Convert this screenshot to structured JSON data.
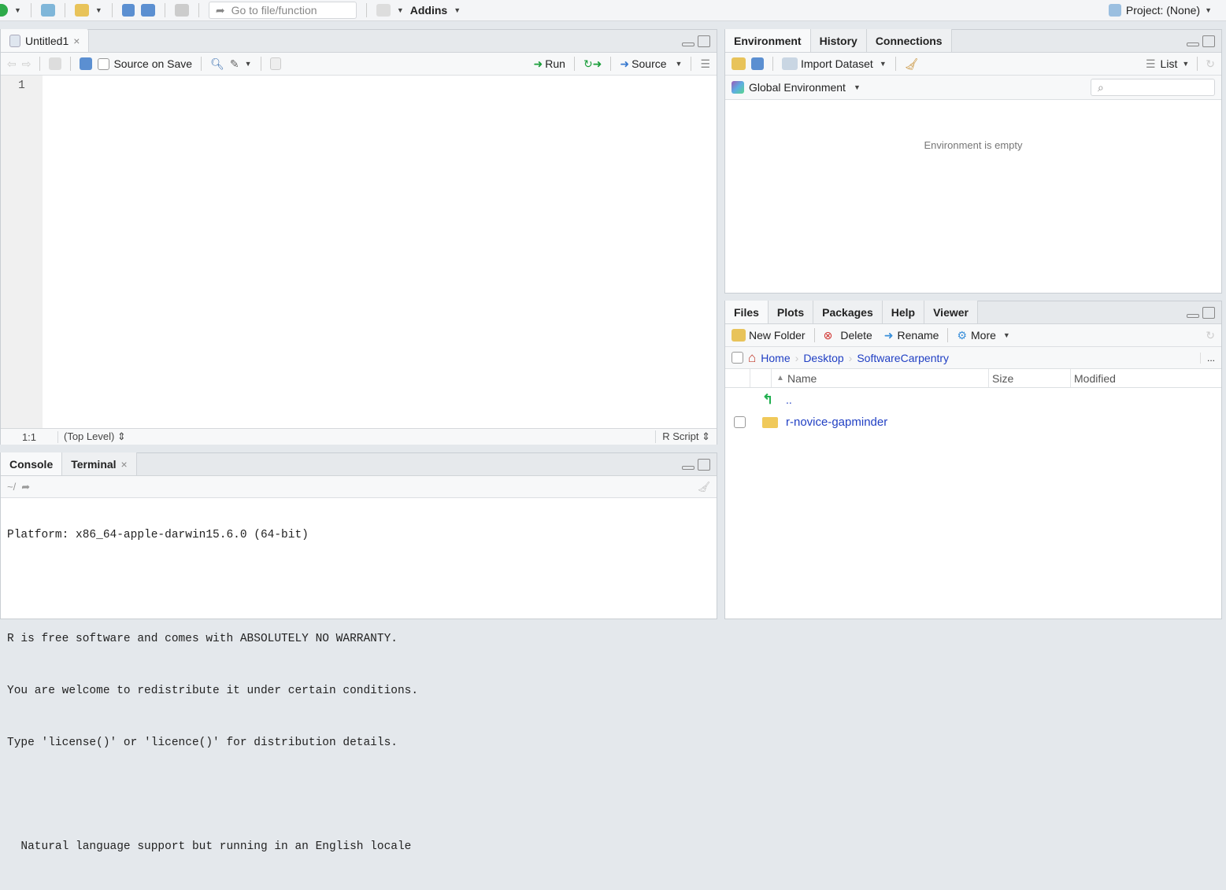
{
  "topbar": {
    "goto_placeholder": "Go to file/function",
    "addins": "Addins",
    "project": "Project: (None)"
  },
  "editor": {
    "tab": "Untitled1",
    "source_on_save": "Source on Save",
    "run": "Run",
    "source": "Source",
    "line_number": "1",
    "position": "1:1",
    "scope": "(Top Level)",
    "file_type": "R Script"
  },
  "console": {
    "tabs": [
      "Console",
      "Terminal"
    ],
    "path": "~/",
    "lines": [
      "Platform: x86_64-apple-darwin15.6.0 (64-bit)",
      "",
      "R is free software and comes with ABSOLUTELY NO WARRANTY.",
      "You are welcome to redistribute it under certain conditions.",
      "Type 'license()' or 'licence()' for distribution details.",
      "",
      "  Natural language support but running in an English locale"
    ]
  },
  "environment": {
    "tabs": [
      "Environment",
      "History",
      "Connections"
    ],
    "import_dataset": "Import Dataset",
    "view": "List",
    "scope": "Global Environment",
    "empty_message": "Environment is empty"
  },
  "files": {
    "tabs": [
      "Files",
      "Plots",
      "Packages",
      "Help",
      "Viewer"
    ],
    "new_folder": "New Folder",
    "delete": "Delete",
    "rename": "Rename",
    "more": "More",
    "breadcrumb": [
      "Home",
      "Desktop",
      "SoftwareCarpentry"
    ],
    "more_path": "...",
    "columns": [
      "Name",
      "Size",
      "Modified"
    ],
    "rows": [
      {
        "name": ".."
      },
      {
        "name": "r-novice-gapminder"
      }
    ]
  }
}
